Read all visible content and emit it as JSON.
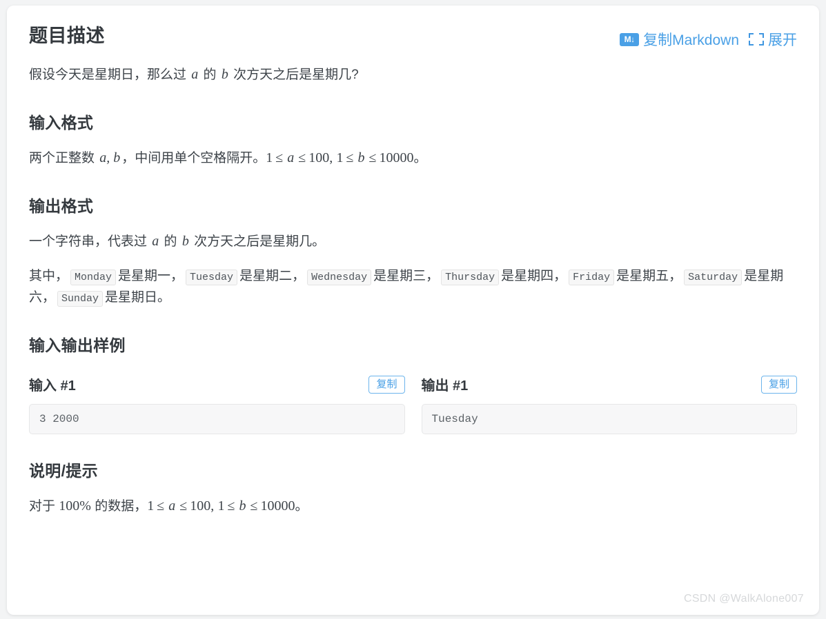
{
  "header": {
    "title": "题目描述",
    "copy_markdown_label": "复制Markdown",
    "markdown_icon_text": "M↓",
    "expand_label": "展开",
    "accent_color": "#4aa0e6"
  },
  "description": {
    "text_before_a": "假设今天是星期日，那么过 ",
    "var_a": "a",
    "text_mid": " 的 ",
    "var_b": "b",
    "text_after": " 次方天之后是星期几?"
  },
  "input_format": {
    "heading": "输入格式",
    "text_1": "两个正整数 ",
    "vars": "a, b",
    "text_2": "，中间用单个空格隔开。",
    "constraint_1_lo": "1",
    "constraint_1_op1": "≤",
    "constraint_1_var": "a",
    "constraint_1_op2": "≤",
    "constraint_1_hi": "100",
    "comma": ",",
    "constraint_2_lo": "1",
    "constraint_2_op1": "≤",
    "constraint_2_var": "b",
    "constraint_2_op2": "≤",
    "constraint_2_hi": "10000",
    "period": "。"
  },
  "output_format": {
    "heading": "输出格式",
    "text_1": "一个字符串，代表过 ",
    "var_a": "a",
    "text_2": " 的 ",
    "var_b": "b",
    "text_3": " 次方天之后是星期几。",
    "mapping_prefix": "其中，",
    "days": [
      {
        "code": "Monday",
        "label": "是星期一，"
      },
      {
        "code": "Tuesday",
        "label": "是星期二，"
      },
      {
        "code": "Wednesday",
        "label": "是星期三，"
      },
      {
        "code": "Thursday",
        "label": "是星期四，"
      },
      {
        "code": "Friday",
        "label": "是星期五，"
      },
      {
        "code": "Saturday",
        "label": "是星期六，"
      },
      {
        "code": "Sunday",
        "label": "是星期日。"
      }
    ]
  },
  "samples": {
    "heading": "输入输出样例",
    "copy_label": "复制",
    "items": [
      {
        "title": "输入 #1",
        "content": "3 2000"
      },
      {
        "title": "输出 #1",
        "content": "Tuesday"
      }
    ]
  },
  "hint": {
    "heading": "说明/提示",
    "text_1": "对于 ",
    "percent": "100%",
    "text_2": " 的数据，",
    "c1_lo": "1",
    "c1_op1": "≤",
    "c1_var": "a",
    "c1_op2": "≤",
    "c1_hi": "100",
    "comma": ",",
    "c2_lo": "1",
    "c2_op1": "≤",
    "c2_var": "b",
    "c2_op2": "≤",
    "c2_hi": "10000",
    "period": "。"
  },
  "watermark": "CSDN @WalkAlone007"
}
